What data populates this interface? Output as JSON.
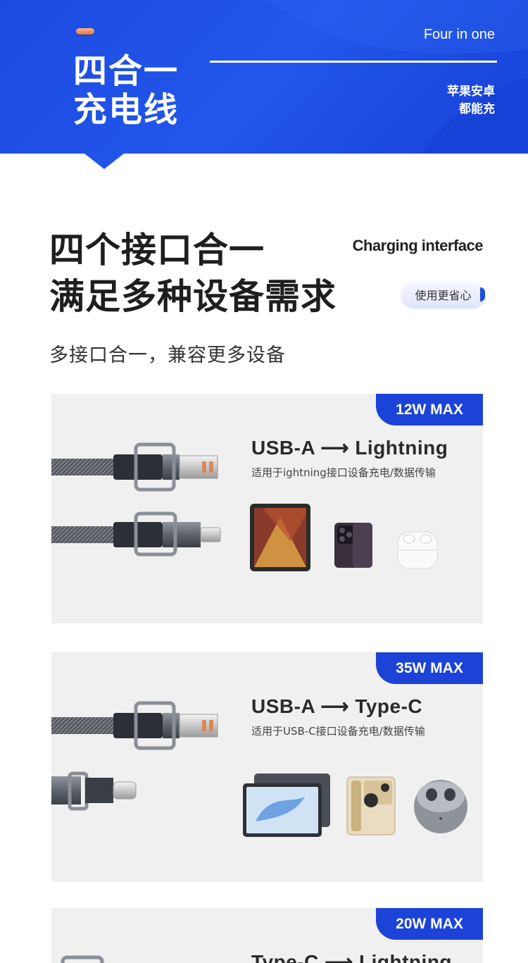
{
  "banner": {
    "title_line1": "四合一",
    "title_line2": "充电线",
    "english": "Four in one",
    "sub_line1": "苹果安卓",
    "sub_line2": "都能充"
  },
  "intro": {
    "headline_line1": "四个接口合一",
    "headline_line2": "满足多种设备需求",
    "label": "Charging interface",
    "badge": "使用更省心",
    "subtitle": "多接口合一，兼容更多设备"
  },
  "cards": [
    {
      "power": "12W MAX",
      "title": "USB-A ⟶ Lightning",
      "desc": "适用于ightning接口设备充电/数据传输",
      "connectors": [
        "usb-a-plug",
        "lightning-plug"
      ],
      "devices": [
        "ipad-icon",
        "iphone-icon",
        "airpods-icon"
      ]
    },
    {
      "power": "35W MAX",
      "title": "USB-A ⟶ Type-C",
      "desc": "适用于USB-C接口设备充电/数据传输",
      "connectors": [
        "usb-a-plug",
        "usb-c-plug"
      ],
      "devices": [
        "tablet-icon",
        "android-phone-icon",
        "earbuds-case-icon"
      ]
    },
    {
      "power": "20W MAX",
      "title": "Type-C ⟶ Lightning",
      "desc": "",
      "connectors": [
        "usb-c-plug"
      ],
      "devices": []
    }
  ],
  "colors": {
    "brand_blue": "#1c43d8",
    "banner_blue": "#1f4fe6",
    "card_bg": "#f0f0f0",
    "accent_orange": "#e2763f"
  }
}
